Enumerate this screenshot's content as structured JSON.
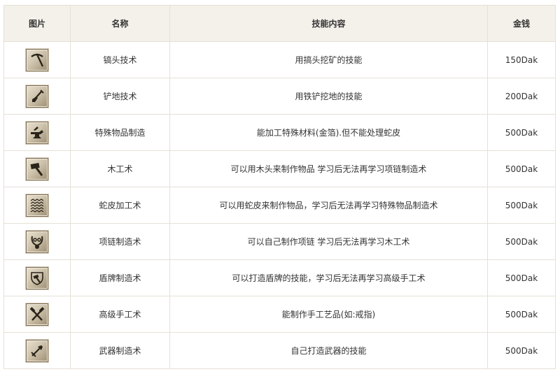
{
  "headers": {
    "icon": "图片",
    "name": "名称",
    "desc": "技能内容",
    "price": "金钱"
  },
  "rows": [
    {
      "icon": "pickaxe-icon",
      "name": "镐头技术",
      "desc": "用搞头挖矿的技能",
      "price": "150Dak"
    },
    {
      "icon": "shovel-icon",
      "name": "铲地技术",
      "desc": "用铁铲挖地的技能",
      "price": "200Dak"
    },
    {
      "icon": "anvil-icon",
      "name": "特殊物品制造",
      "desc": "能加工特殊材料(金箔).但不能处理蛇皮",
      "price": "500Dak"
    },
    {
      "icon": "hammer-icon",
      "name": "木工术",
      "desc": "可以用木头来制作物品 学习后无法再学习项链制造术",
      "price": "500Dak"
    },
    {
      "icon": "snakeskin-icon",
      "name": "蛇皮加工术",
      "desc": "可以用蛇皮来制作物品，学习后无法再学习特殊物品制造术",
      "price": "500Dak"
    },
    {
      "icon": "necklace-icon",
      "name": "项链制造术",
      "desc": "可以自己制作项链 学习后无法再学习木工术",
      "price": "500Dak"
    },
    {
      "icon": "shield-hammer-icon",
      "name": "盾牌制造术",
      "desc": "可以打造盾牌的技能，学习后无法再学习高级手工术",
      "price": "500Dak"
    },
    {
      "icon": "crossed-hammers-icon",
      "name": "高级手工术",
      "desc": "能制作手工艺品(如:戒指)",
      "price": "500Dak"
    },
    {
      "icon": "weapon-forge-icon",
      "name": "武器制造术",
      "desc": "自己打造武器的技能",
      "price": "500Dak"
    }
  ]
}
